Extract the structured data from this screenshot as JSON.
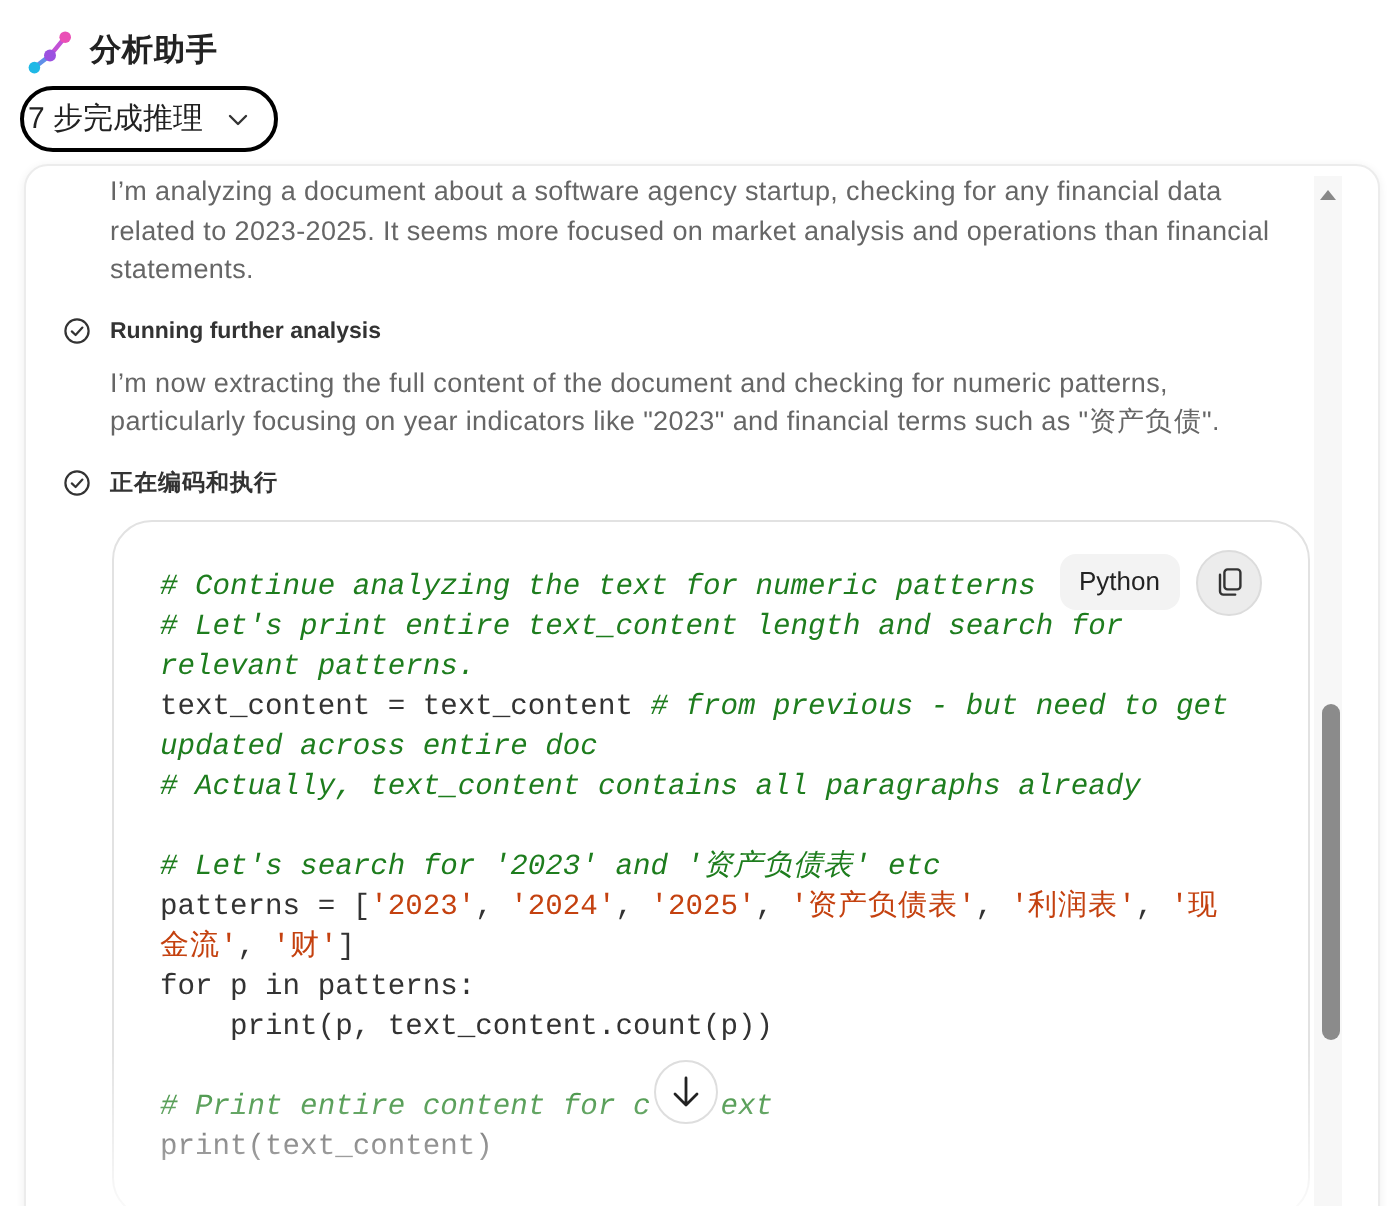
{
  "header": {
    "title": "分析助手"
  },
  "reasoning_toggle": {
    "label": "7 步完成推理"
  },
  "reasoning": {
    "items": [
      {
        "kind": "note",
        "text": "I’m analyzing a document about a software agency startup, checking for any financial data related to 2023-2025. It seems more focused on market analysis and operations than financial statements."
      },
      {
        "kind": "step",
        "done": true,
        "title": "Running further analysis",
        "text": "I’m now extracting the full content of the document and checking for numeric patterns, particularly focusing on year indicators like \"2023\" and financial terms such as \"资产负债\"."
      },
      {
        "kind": "step",
        "done": true,
        "title": "正在编码和执行",
        "code": {
          "language": "Python",
          "blocks": [
            [
              [
                {
                  "kind": "comment",
                  "text": "# Continue analyzing the text for numeric patterns"
                }
              ],
              [
                {
                  "kind": "comment",
                  "text": "# Let's print entire text_content length and search for"
                }
              ],
              [
                {
                  "kind": "comment",
                  "text": "relevant patterns."
                }
              ],
              [
                {
                  "kind": "plain",
                  "text": "text_content = text_content "
                },
                {
                  "kind": "comment",
                  "text": "# from previous - but need to get"
                }
              ],
              [
                {
                  "kind": "comment",
                  "text": "updated across entire doc"
                }
              ],
              [
                {
                  "kind": "comment",
                  "text": "# Actually, text_content contains all paragraphs already"
                }
              ]
            ],
            [
              [
                {
                  "kind": "comment",
                  "text": "# Let's search for '2023' and '资产负债表' etc"
                }
              ],
              [
                {
                  "kind": "plain",
                  "text": "patterns = ["
                },
                {
                  "kind": "string",
                  "text": "'2023'"
                },
                {
                  "kind": "plain",
                  "text": ", "
                },
                {
                  "kind": "string",
                  "text": "'2024'"
                },
                {
                  "kind": "plain",
                  "text": ", "
                },
                {
                  "kind": "string",
                  "text": "'2025'"
                },
                {
                  "kind": "plain",
                  "text": ", "
                },
                {
                  "kind": "string",
                  "text": "'资产负债表'"
                },
                {
                  "kind": "plain",
                  "text": ", "
                },
                {
                  "kind": "string",
                  "text": "'利润表'"
                },
                {
                  "kind": "plain",
                  "text": ", "
                },
                {
                  "kind": "string",
                  "text": "'现"
                }
              ],
              [
                {
                  "kind": "string",
                  "text": "金流'"
                },
                {
                  "kind": "plain",
                  "text": ", "
                },
                {
                  "kind": "string",
                  "text": "'财'"
                },
                {
                  "kind": "plain",
                  "text": "]"
                }
              ],
              [
                {
                  "kind": "plain",
                  "text": "for p in patterns:"
                }
              ],
              [
                {
                  "kind": "plain",
                  "text": "    print(p, text_content.count(p))"
                }
              ]
            ],
            [
              [
                {
                  "kind": "comment",
                  "text": "# Print entire content for c"
                },
                {
                  "kind": "covered"
                },
                {
                  "kind": "comment",
                  "text": "ext"
                }
              ],
              [
                {
                  "kind": "plain",
                  "text": "print(text_content)"
                }
              ]
            ]
          ]
        }
      }
    ]
  }
}
